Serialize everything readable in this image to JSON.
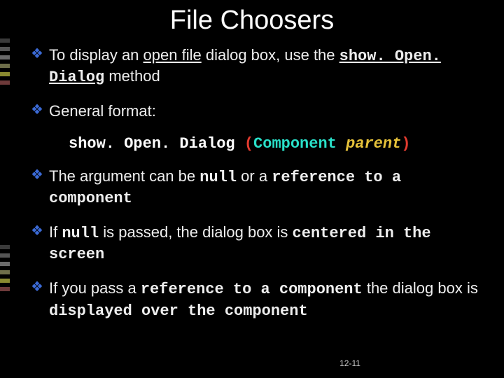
{
  "title": "File Choosers",
  "bullets": {
    "b1": {
      "pre": "To display an ",
      "u1": "open file",
      "mid": " dialog box, use the ",
      "code": "show. Open. Dialog",
      "post": " method"
    },
    "b2": {
      "pre": "General format:"
    },
    "code": {
      "method": "show. Open. Dialog ",
      "paren_l": "(",
      "type": "Component ",
      "param": "parent",
      "paren_r": ")"
    },
    "b3": {
      "pre": "The argument can be ",
      "c1": "null",
      "mid": " or a ",
      "c2": "reference to a component"
    },
    "b4": {
      "pre": "If ",
      "c1": "null",
      "mid": " is passed, the dialog box is ",
      "c2": "centered in the screen"
    },
    "b5": {
      "pre": "If you pass a  ",
      "c1": "reference to a component",
      "mid": " the dialog box is ",
      "c2": "displayed over the component"
    }
  },
  "pagenum": "12-11"
}
